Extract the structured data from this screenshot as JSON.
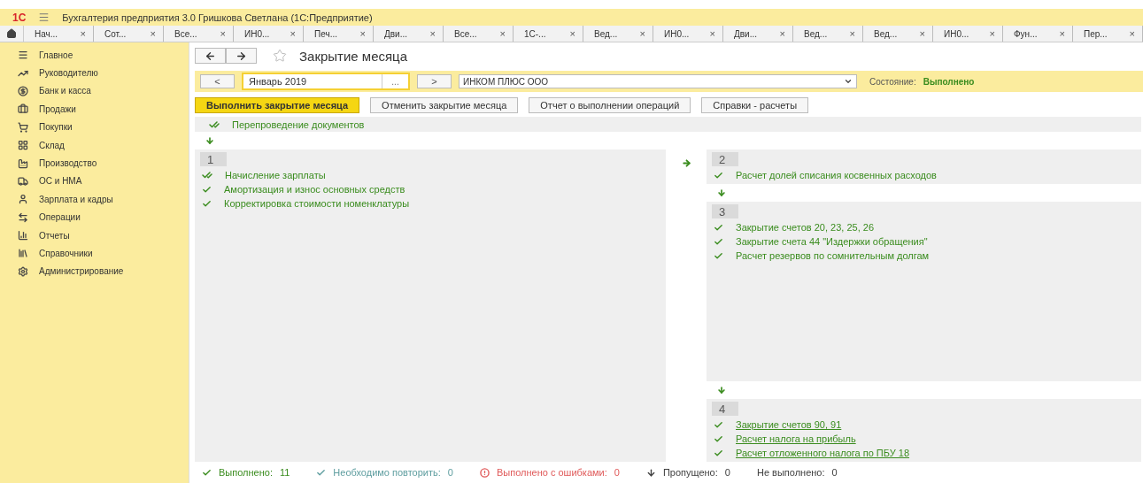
{
  "app_bar": {
    "logo": "1С",
    "title": "Бухгалтерия предприятия 3.0 Гришкова Светлана  (1С:Предприятие)"
  },
  "tabs": [
    {
      "label": "Нач..."
    },
    {
      "label": "Сот..."
    },
    {
      "label": "Все..."
    },
    {
      "label": "ИН0..."
    },
    {
      "label": "Печ..."
    },
    {
      "label": "Дви..."
    },
    {
      "label": "Все..."
    },
    {
      "label": "1С-..."
    },
    {
      "label": "Вед..."
    },
    {
      "label": "ИН0..."
    },
    {
      "label": "Дви..."
    },
    {
      "label": "Вед..."
    },
    {
      "label": "Вед..."
    },
    {
      "label": "ИН0..."
    },
    {
      "label": "Фун..."
    },
    {
      "label": "Пер..."
    }
  ],
  "tab_close": "×",
  "sidebar": {
    "items": [
      {
        "label": "Главное"
      },
      {
        "label": "Руководителю"
      },
      {
        "label": "Банк и касса"
      },
      {
        "label": "Продажи"
      },
      {
        "label": "Покупки"
      },
      {
        "label": "Склад"
      },
      {
        "label": "Производство"
      },
      {
        "label": "ОС и НМА"
      },
      {
        "label": "Зарплата и кадры"
      },
      {
        "label": "Операции"
      },
      {
        "label": "Отчеты"
      },
      {
        "label": "Справочники"
      },
      {
        "label": "Администрирование"
      }
    ]
  },
  "page": {
    "title": "Закрытие месяца",
    "period": {
      "prev": "<",
      "value": "Январь 2019",
      "choose": "...",
      "next": ">"
    },
    "organization": {
      "value": "ИНКОМ ПЛЮС ООО"
    },
    "state": {
      "label": "Состояние:",
      "value": "Выполнено"
    },
    "buttons": [
      {
        "label": "Выполнить закрытие месяца",
        "primary": true
      },
      {
        "label": "Отменить закрытие месяца",
        "primary": false
      },
      {
        "label": "Отчет о выполнении операций",
        "primary": false
      },
      {
        "label": "Справки - расчеты",
        "primary": false
      }
    ],
    "pre_step": {
      "kind": "done-edit",
      "label": "Перепроведение документов",
      "link": false
    },
    "left_groups": [
      {
        "number": "1",
        "items": [
          {
            "kind": "done-edit",
            "label": "Начисление зарплаты",
            "link": false
          },
          {
            "kind": "done",
            "label": "Амортизация и износ основных средств",
            "link": false
          },
          {
            "kind": "done",
            "label": "Корректировка стоимости номенклатуры",
            "link": false
          }
        ]
      }
    ],
    "right_groups": [
      {
        "number": "2",
        "items": [
          {
            "kind": "done",
            "label": "Расчет долей списания косвенных расходов",
            "link": false
          }
        ]
      },
      {
        "number": "3",
        "items": [
          {
            "kind": "done",
            "label": "Закрытие счетов 20, 23, 25, 26",
            "link": false
          },
          {
            "kind": "done",
            "label": "Закрытие счета 44 \"Издержки обращения\"",
            "link": false
          },
          {
            "kind": "done",
            "label": "Расчет резервов по сомнительным долгам",
            "link": false
          }
        ]
      },
      {
        "number": "4",
        "items": [
          {
            "kind": "done",
            "label": "Закрытие счетов 90, 91",
            "link": true
          },
          {
            "kind": "done",
            "label": "Расчет налога на прибыль",
            "link": true
          },
          {
            "kind": "done",
            "label": "Расчет отложенного налога по ПБУ 18",
            "link": true
          }
        ]
      }
    ],
    "legend": [
      {
        "kind": "done",
        "label": "Выполнено:",
        "count": "11",
        "color": "#3a8c1e"
      },
      {
        "kind": "repeat",
        "label": "Необходимо повторить:",
        "count": "0",
        "color": "#5f9ea0"
      },
      {
        "kind": "error",
        "label": "Выполнено с ошибками:",
        "count": "0",
        "color": "#e05a5a"
      },
      {
        "kind": "skipped",
        "label": "Пропущено:",
        "count": "0",
        "color": "#404040"
      },
      {
        "kind": "none",
        "label": "Не выполнено:",
        "count": "0",
        "color": "#404040"
      }
    ]
  }
}
